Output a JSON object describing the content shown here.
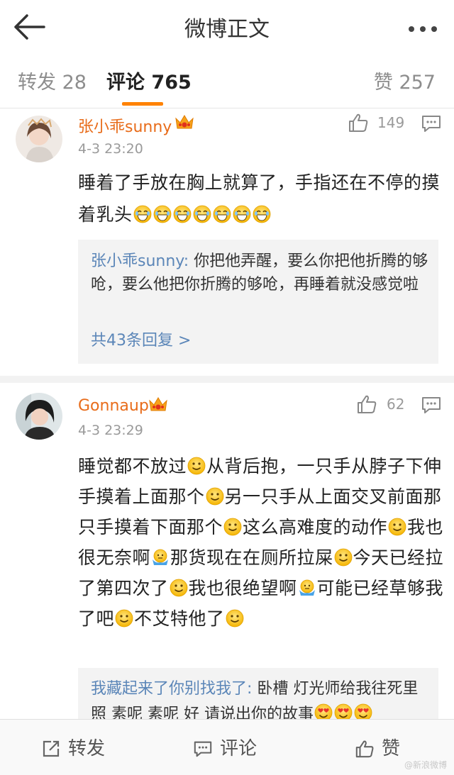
{
  "header": {
    "title": "微博正文"
  },
  "tabs": [
    {
      "label": "转发",
      "count": "28"
    },
    {
      "label": "评论",
      "count": "765"
    },
    {
      "label": "赞",
      "count": "257"
    }
  ],
  "comments": [
    {
      "username": "张小乖sunny",
      "time": "4-3 23:20",
      "likes": "149",
      "text": "睡着了手放在胸上就算了，手指还在不停的摸着乳头",
      "emoji_count": 7,
      "reply": {
        "name": "张小乖sunny:",
        "text": " 你把他弄醒，要么你把他折腾的够呛，要么他把你折腾的够呛，再睡着就没感觉啦",
        "more": "共43条回复 >"
      }
    },
    {
      "username": "Gonnaup",
      "time": "4-3 23:29",
      "likes": "62",
      "segments": [
        "睡觉都不放过",
        "从背后抱，一只手从脖子下伸手摸着上面那个",
        "另一只手从上面交叉前面那只手摸着下面那个",
        "这么高难度的动作",
        "我也很无奈啊",
        "那货现在在厕所拉屎",
        "今天已经拉了第四次了",
        "我也很绝望啊",
        "可能已经草够我了吧",
        "不艾特他了"
      ],
      "reply": {
        "name": "我藏起来了你别找我了:",
        "text": " 卧槽 灯光师给我往死里照 素呢 素呢 好 请说出你的故事"
      }
    }
  ],
  "bottombar": {
    "repost_label": "转发",
    "comment_label": "评论",
    "like_label": "赞"
  },
  "watermark": "@新浪微博",
  "colors": {
    "accent": "#ff8200",
    "username": "#e86c1a",
    "link": "#5b86b8"
  }
}
